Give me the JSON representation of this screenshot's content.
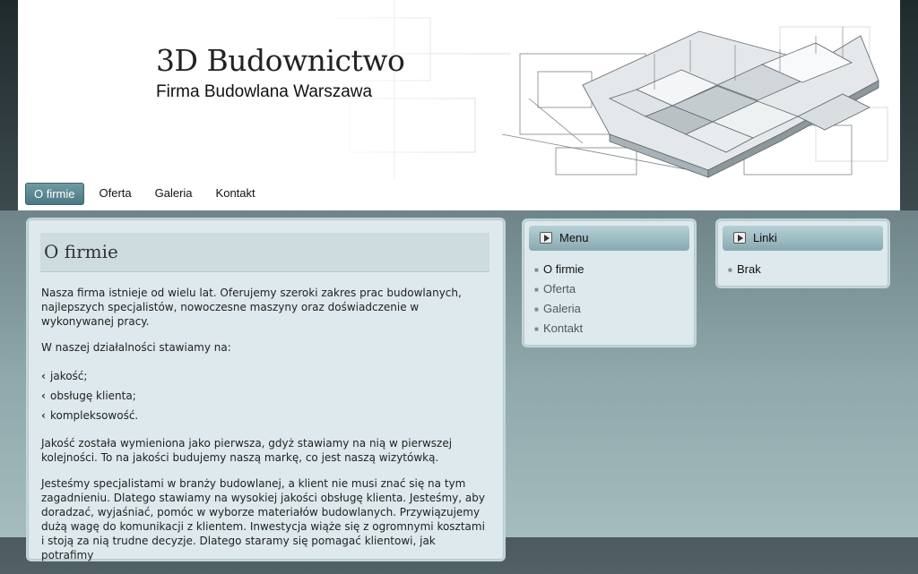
{
  "header": {
    "title": "3D Budownictwo",
    "subtitle": "Firma Budowlana Warszawa"
  },
  "nav": {
    "items": [
      {
        "label": "O firmie",
        "active": true
      },
      {
        "label": "Oferta"
      },
      {
        "label": "Galeria"
      },
      {
        "label": "Kontakt"
      }
    ]
  },
  "content": {
    "title": "O firmie",
    "intro": "Nasza firma istnieje od wielu lat. Oferujemy szeroki zakres prac budowlanych, najlepszych specjalistów, nowoczesne maszyny oraz doświadczenie w wykonywanej pracy.",
    "list_intro": "W naszej działalności stawiamy na:",
    "features": [
      "jakość;",
      "obsługę klienta;",
      "kompleksowość."
    ],
    "para2": "Jakość została wymieniona jako pierwsza, gdyż stawiamy na nią w pierwszej kolejności. To na jakości budujemy naszą markę, co jest naszą wizytówką.",
    "para3": "Jesteśmy specjalistami w branży budowlanej, a klient nie musi znać się na tym zagadnieniu. Dlatego stawiamy na wysokiej jakości obsługę klienta. Jesteśmy, aby doradzać, wyjaśniać, pomóc w wyborze materiałów budowlanych. Przywiązujemy dużą wagę do komunikacji z klientem. Inwestycja wiąże się z ogromnymi kosztami i stoją za nią trudne decyzje. Dlatego staramy się pomagać klientowi, jak potrafimy"
  },
  "menu_box": {
    "title": "Menu",
    "items": [
      "O firmie",
      "Oferta",
      "Galeria",
      "Kontakt"
    ]
  },
  "links_box": {
    "title": "Linki",
    "items": [
      "Brak"
    ]
  },
  "icons": {
    "box_header": "play-arrow-icon",
    "list_bullet": "bullet-icon",
    "feature_marker": "chevron-left-icon"
  }
}
